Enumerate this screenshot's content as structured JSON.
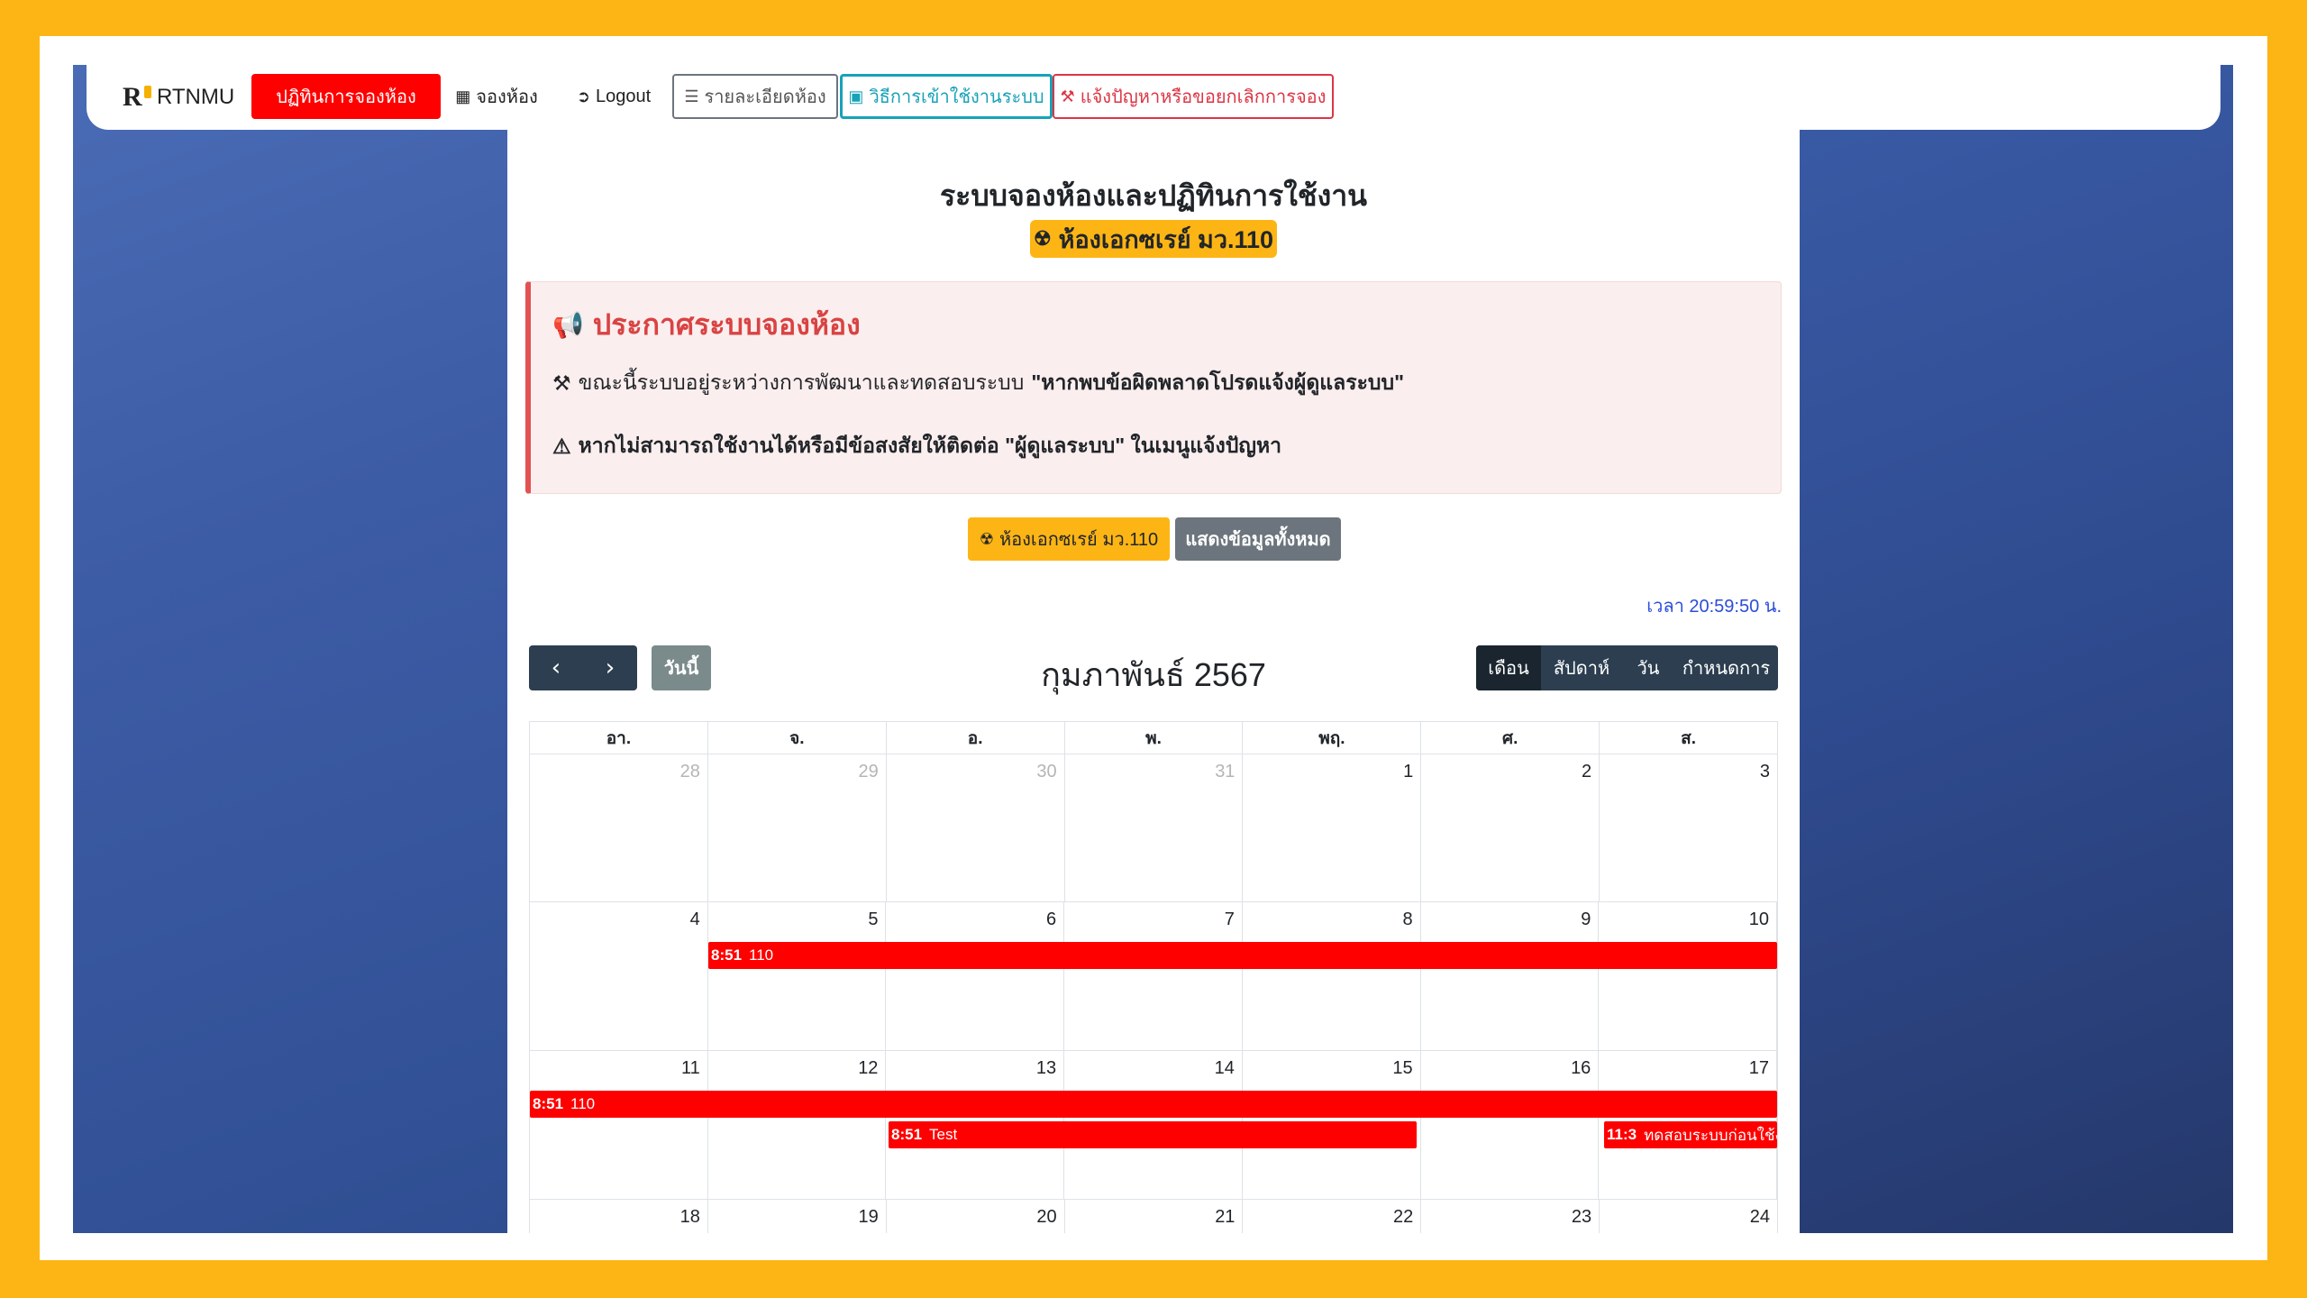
{
  "navbar": {
    "brand": "RTNMU",
    "nav_calendar": "ปฏิทินการจองห้อง",
    "nav_book": "จองห้อง",
    "nav_logout": "Logout",
    "nav_room_details": "รายละเอียดห้อง",
    "nav_howto": "วิธีการเข้าใช้งานระบบ",
    "nav_report": "แจ้งปัญหาหรือขอยกเลิกการจอง"
  },
  "header": {
    "title": "ระบบจองห้องและปฏิทินการใช้งาน",
    "room_badge": "ห้องเอกซเรย์ มว.110"
  },
  "announcement": {
    "title": "ประกาศระบบจองห้อง",
    "line1_prefix": "ขณะนี้ระบบอยู่ระหว่างการพัฒนาและทดสอบระบบ",
    "line1_bold": "\"หากพบข้อผิดพลาดโปรดแจ้งผู้ดูแลระบบ\"",
    "line2": "หากไม่สามารถใช้งานได้หรือมีข้อสงสัยให้ติดต่อ \"ผู้ดูแลระบบ\" ในเมนูแจ้งปัญหา"
  },
  "filters": {
    "room": "ห้องเอกซเรย์ มว.110",
    "show_all": "แสดงข้อมูลทั้งหมด"
  },
  "clock": "เวลา 20:59:50 น.",
  "calendar": {
    "title": "กุมภาพันธ์ 2567",
    "today": "วันนี้",
    "prev_icon": "chevron-left-icon",
    "next_icon": "chevron-right-icon",
    "views": [
      "เดือน",
      "สัปดาห์",
      "วัน",
      "กำหนดการ"
    ],
    "active_view": "เดือน",
    "weekdays": [
      "อา.",
      "จ.",
      "อ.",
      "พ.",
      "พฤ.",
      "ศ.",
      "ส."
    ],
    "weeks": [
      [
        "28",
        "29",
        "30",
        "31",
        "1",
        "2",
        "3"
      ],
      [
        "4",
        "5",
        "6",
        "7",
        "8",
        "9",
        "10"
      ],
      [
        "11",
        "12",
        "13",
        "14",
        "15",
        "16",
        "17"
      ],
      [
        "18",
        "19",
        "20",
        "21",
        "22",
        "23",
        "24"
      ]
    ],
    "events": [
      {
        "time": "8:51",
        "title": "110"
      },
      {
        "time": "8:51",
        "title": "110"
      },
      {
        "time": "8:51",
        "title": "Test"
      },
      {
        "time": "11:3",
        "title": "ทดสอบระบบก่อนใช้งาน"
      }
    ]
  },
  "colors": {
    "frame": "#FDB515",
    "accent_red": "#ff0000",
    "dark_nav": "#2c3e50",
    "badge_yellow": "#FDB515"
  }
}
